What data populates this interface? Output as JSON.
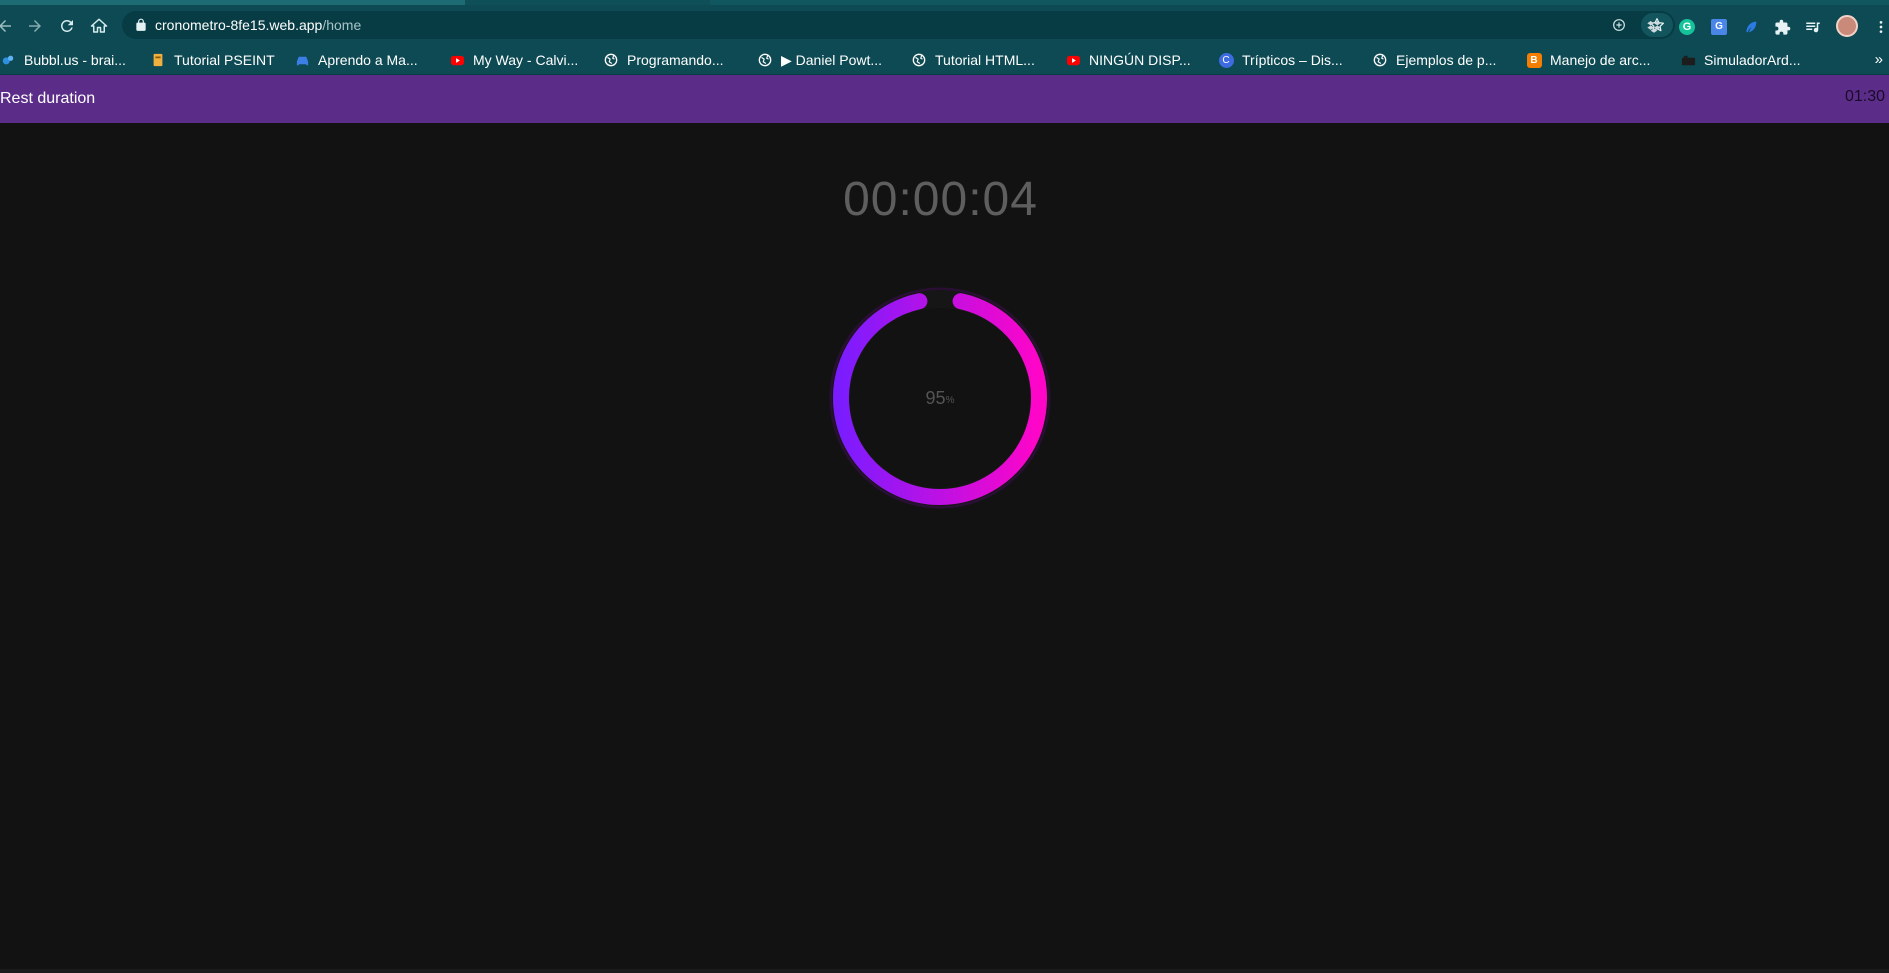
{
  "browser": {
    "url_host": "cronometro-8fe15.web.app",
    "url_path": "/home",
    "bookmarks": [
      {
        "label": "Bubbl.us - brai...",
        "icon": "bubbl-icon",
        "color": "#2f8fe0"
      },
      {
        "label": "Tutorial PSEINT",
        "icon": "pseint-icon",
        "color": "#f0b040"
      },
      {
        "label": "Aprendo a Ma...",
        "icon": "car-icon",
        "color": "#3b7fe6"
      },
      {
        "label": "My Way - Calvi...",
        "icon": "youtube-icon",
        "color": "#ff0000"
      },
      {
        "label": "Programando...",
        "icon": "globe-icon",
        "color": "#ffffff"
      },
      {
        "label": "▶ Daniel Powt...",
        "icon": "globe-icon",
        "color": "#ffffff"
      },
      {
        "label": "Tutorial HTML...",
        "icon": "globe-icon",
        "color": "#ffffff"
      },
      {
        "label": "NINGÚN DISP...",
        "icon": "youtube-icon",
        "color": "#ff0000"
      },
      {
        "label": "Trípticos – Dis...",
        "icon": "canva-icon",
        "color": "#3d6be0"
      },
      {
        "label": "Ejemplos de p...",
        "icon": "globe-icon",
        "color": "#ffffff"
      },
      {
        "label": "Manejo de arc...",
        "icon": "blogger-icon",
        "color": "#f57d00"
      },
      {
        "label": "SimuladorArd...",
        "icon": "tinkercad-icon",
        "color": "#1d1d1d"
      }
    ],
    "overflow": "»"
  },
  "app": {
    "header_title": "Rest duration",
    "rest_duration": "01:30",
    "elapsed": "00:00:04",
    "progress": {
      "percent_label": "95",
      "percent_unit": "%",
      "value": 0.95,
      "gradient_start": "#7b1cff",
      "gradient_end": "#ff05c8"
    }
  }
}
